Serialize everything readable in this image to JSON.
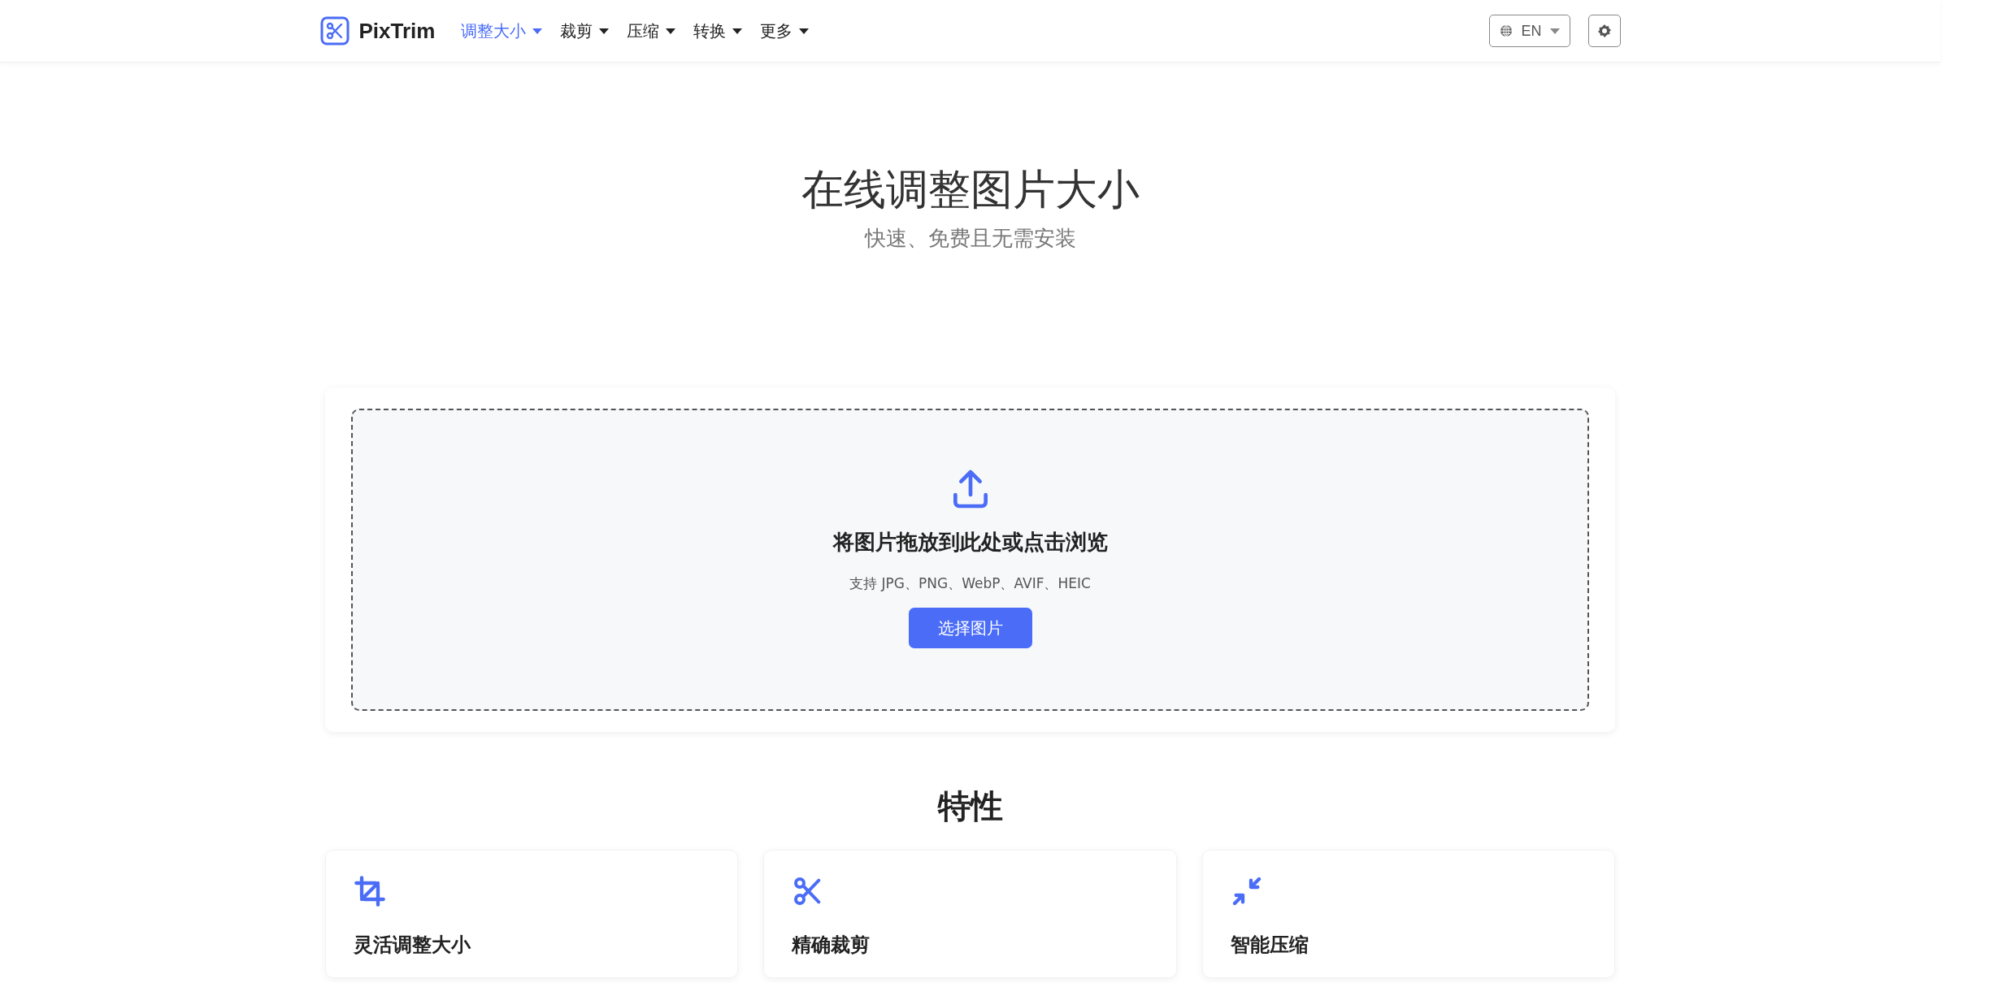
{
  "navbar": {
    "brand": "PixTrim",
    "menu": [
      {
        "label": "调整大小",
        "selected": true
      },
      {
        "label": "裁剪",
        "selected": false
      },
      {
        "label": "压缩",
        "selected": false
      },
      {
        "label": "转换",
        "selected": false
      },
      {
        "label": "更多",
        "selected": false
      }
    ],
    "language": "EN"
  },
  "hero": {
    "title": "在线调整图片大小",
    "subtitle": "快速、免费且无需安装"
  },
  "upload": {
    "heading": "将图片拖放到此处或点击浏览",
    "formats": "支持 JPG、PNG、WebP、AVIF、HEIC",
    "button": "选择图片"
  },
  "features": {
    "title": "特性",
    "items": [
      {
        "kind": "crop",
        "title": "灵活调整大小"
      },
      {
        "kind": "scissors",
        "title": "精确裁剪"
      },
      {
        "kind": "compress",
        "title": "智能压缩"
      }
    ]
  }
}
